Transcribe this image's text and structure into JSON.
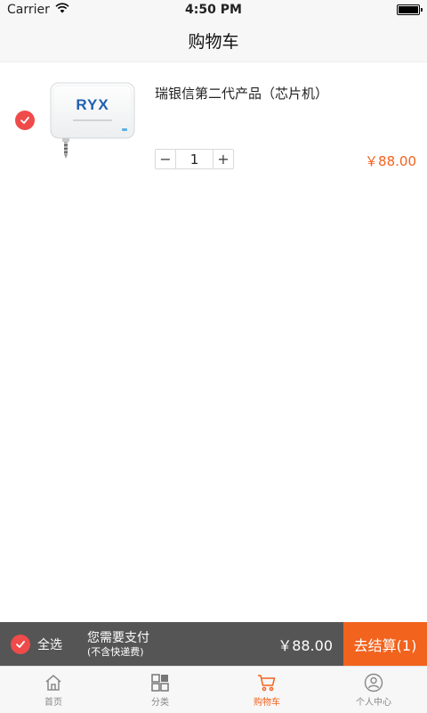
{
  "status_bar": {
    "carrier": "Carrier",
    "time": "4:50 PM"
  },
  "nav": {
    "title": "购物车"
  },
  "cart": {
    "items": [
      {
        "name": "瑞银信第二代产品（芯片机）",
        "quantity": "1",
        "price": "￥88.00",
        "checked": true,
        "brand_logo": "RYX",
        "minus_symbol": "−",
        "plus_symbol": "+"
      }
    ]
  },
  "checkout": {
    "select_all_label": "全选",
    "pay_label": "您需要支付",
    "pay_note": "(不含快递费)",
    "total": "￥88.00",
    "button_label": "去结算(1)"
  },
  "tabs": [
    {
      "label": "首页",
      "icon": "home-icon",
      "active": false
    },
    {
      "label": "分类",
      "icon": "category-icon",
      "active": false
    },
    {
      "label": "购物车",
      "icon": "cart-icon",
      "active": true
    },
    {
      "label": "个人中心",
      "icon": "user-icon",
      "active": false
    }
  ],
  "colors": {
    "accent": "#f2631e",
    "check": "#ef4b4b",
    "checkout_bar": "#555555",
    "bar_bg": "#f7f7f7"
  }
}
